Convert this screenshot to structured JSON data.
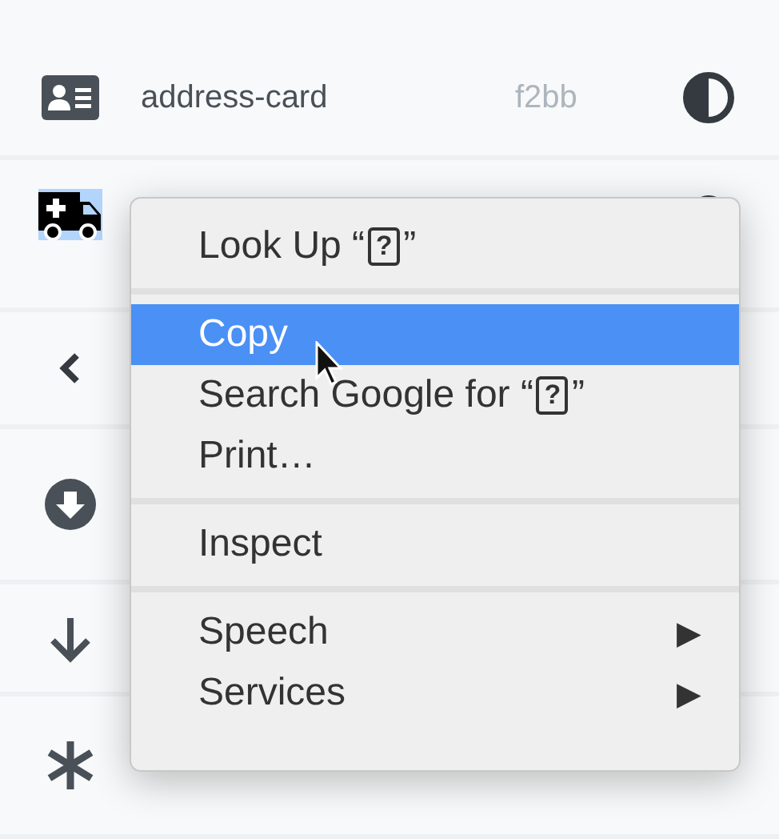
{
  "rows": [
    {
      "selected": false,
      "name": "address-card",
      "code": "f2bb"
    },
    {
      "selected": true
    },
    {
      "selected": false
    },
    {
      "selected": false
    },
    {
      "selected": false
    },
    {
      "selected": false
    }
  ],
  "context_menu": {
    "groups": [
      [
        {
          "label": "Look Up “",
          "glyph": "?",
          "label_end": "”",
          "selected": false
        }
      ],
      [
        {
          "label": "Copy",
          "selected": true
        },
        {
          "label": "Search Google for “",
          "glyph": "?",
          "label_end": "”",
          "selected": false
        },
        {
          "label": "Print…",
          "selected": false
        }
      ],
      [
        {
          "label": "Inspect",
          "selected": false
        }
      ],
      [
        {
          "label": "Speech",
          "selected": false,
          "submenu": "▶"
        },
        {
          "label": "Services",
          "selected": false,
          "submenu": "▶"
        }
      ]
    ]
  }
}
